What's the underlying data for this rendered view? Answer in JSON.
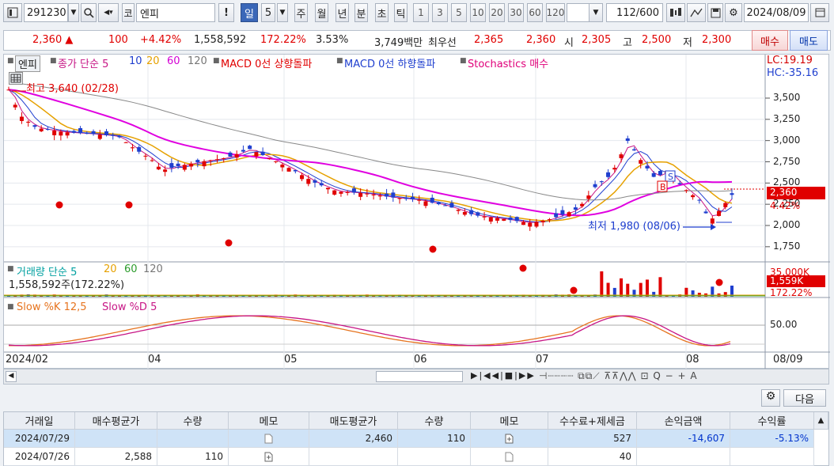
{
  "toolbar": {
    "code": "291230",
    "market": "코",
    "name": "엔피",
    "periods": [
      "일",
      "5",
      "주",
      "월",
      "년",
      "분",
      "초",
      "틱"
    ],
    "selected_period": "일",
    "intervals": [
      "1",
      "3",
      "5",
      "10",
      "20",
      "30",
      "60",
      "120"
    ],
    "count": "112",
    "count_max": "/600",
    "date": "2024/08/09"
  },
  "info": {
    "price": "2,360 ▲",
    "change": "100",
    "change_pct": "+4.42%",
    "volume": "1,558,592",
    "volume_pct": "172.22%",
    "turnover_pct": "3.53%",
    "amount": "3,749백만",
    "best_ask_label": "최우선",
    "best_ask": "2,365",
    "best_bid": "2,360",
    "open_label": "시",
    "open": "2,305",
    "high_label": "고",
    "high": "2,500",
    "low_label": "저",
    "low": "2,300",
    "buy_label": "매수",
    "sell_label": "매도"
  },
  "legend": {
    "tab": "엔피",
    "close_ma": "종가 단순 5",
    "ma10": "10",
    "ma20": "20",
    "ma60": "60",
    "ma120": "120",
    "macd_up": "MACD 0선 상향돌파",
    "macd_down": "MACD 0선 하향돌파",
    "stoch_buy": "Stochastics 매수",
    "lc": "LC:19.19",
    "hc": "HC:-35.16",
    "high_note": "최고 3,640 (02/28)",
    "low_note": "최저 1,980 (08/06)",
    "sig_s": "S",
    "sig_b": "B"
  },
  "chart_data": {
    "type": "candlestick",
    "price_axis": [
      "3,500",
      "3,250",
      "3,000",
      "2,750",
      "2,500",
      "2,250",
      "2,000",
      "1,750"
    ],
    "price_axis_values": [
      3500,
      3250,
      3000,
      2750,
      2500,
      2250,
      2000,
      1750
    ],
    "current_price_label": "2,360",
    "current_pct_label": "4.42%",
    "x_axis_labels": [
      "2024/02",
      "04",
      "05",
      "06",
      "07",
      "08"
    ],
    "x_axis_right": "08/09",
    "volume_legend": "거래량 단순 5",
    "vol_ma20": "20",
    "vol_ma60": "60",
    "vol_ma120": "120",
    "volume_note": "1,558,592주(172.22%)",
    "volume_axis": "35,000K",
    "volume_current": "1,559K",
    "volume_pct": "172.22%",
    "stoch_legend": "Slow %K 12,5",
    "stoch_d": "Slow %D 5",
    "stoch_axis": "50.00"
  },
  "bottom": {
    "next_label": "다음",
    "headers": [
      "거래일",
      "매수평균가",
      "수량",
      "메모",
      "매도평균가",
      "수량",
      "메모",
      "수수료+제세금",
      "손익금액",
      "수익률"
    ],
    "rows": [
      {
        "date": "2024/07/29",
        "buy_avg": "",
        "buy_qty": "",
        "sell_avg": "2,460",
        "sell_qty": "110",
        "fee": "527",
        "pnl": "-14,607",
        "ret": "-5.13%"
      },
      {
        "date": "2024/07/26",
        "buy_avg": "2,588",
        "buy_qty": "110",
        "sell_avg": "",
        "sell_qty": "",
        "fee": "40",
        "pnl": "",
        "ret": ""
      }
    ]
  }
}
